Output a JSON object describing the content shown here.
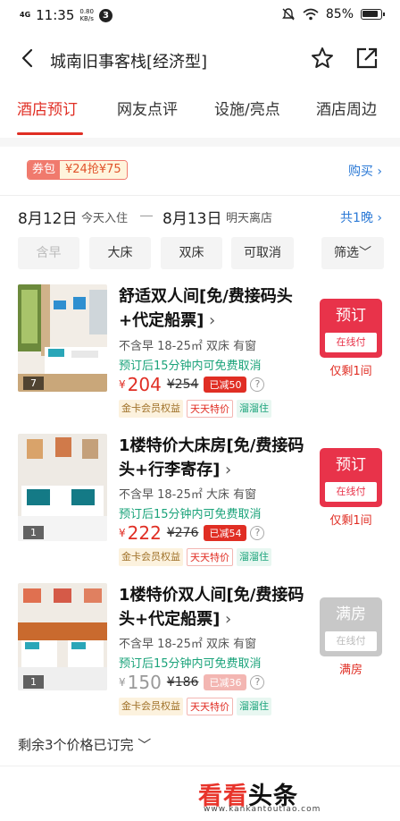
{
  "status_bar": {
    "network": "4G",
    "time": "11:35",
    "speed_value": "0.80",
    "speed_unit": "KB/s",
    "notification_count": "3",
    "battery": "85%"
  },
  "nav": {
    "title": "城南旧事客栈[经济型]",
    "icons": [
      "back-icon",
      "star-icon",
      "share-icon"
    ]
  },
  "tabs": [
    {
      "label": "酒店预订",
      "active": true
    },
    {
      "label": "网友点评",
      "active": false
    },
    {
      "label": "设施/亮点",
      "active": false
    },
    {
      "label": "酒店周边",
      "active": false
    }
  ],
  "coupon": {
    "tag": "券包",
    "text": "¥24抢¥75",
    "buy_label": "购买 ›"
  },
  "dates": {
    "checkin": "8月12日",
    "checkin_note": "今天入住",
    "checkout": "8月13日",
    "checkout_note": "明天离店",
    "nights": "共1晚 ›"
  },
  "filters": [
    {
      "label": "含早",
      "disabled": true
    },
    {
      "label": "大床",
      "disabled": false
    },
    {
      "label": "双床",
      "disabled": false
    },
    {
      "label": "可取消",
      "disabled": false
    },
    {
      "label": "筛选﹀",
      "disabled": false
    }
  ],
  "rooms": [
    {
      "name": "舒适双人间[免/费接码头+代定船票]",
      "photo_count": "7",
      "meta": "不含早 18-25㎡ 双床 有窗",
      "cancel": "预订后15分钟内可免费取消",
      "currency": "¥",
      "price": "204",
      "original_price": "¥254",
      "discount": "已减50",
      "help": "?",
      "tags": [
        "金卡会员权益",
        "天天特价",
        "溜溜住"
      ],
      "button_label": "预订",
      "button_sub": "在线付",
      "status": "仅剩1间",
      "sold_out": false
    },
    {
      "name": "1楼特价大床房[免/费接码头+行李寄存]",
      "photo_count": "1",
      "meta": "不含早 18-25㎡ 大床 有窗",
      "cancel": "预订后15分钟内可免费取消",
      "currency": "¥",
      "price": "222",
      "original_price": "¥276",
      "discount": "已减54",
      "help": "?",
      "tags": [
        "金卡会员权益",
        "天天特价",
        "溜溜住"
      ],
      "button_label": "预订",
      "button_sub": "在线付",
      "status": "仅剩1间",
      "sold_out": false
    },
    {
      "name": "1楼特价双人间[免/费接码头+代定船票]",
      "photo_count": "1",
      "meta": "不含早 18-25㎡ 双床 有窗",
      "cancel": "预订后15分钟内可免费取消",
      "currency": "¥",
      "price": "150",
      "original_price": "¥186",
      "discount": "已减36",
      "help": "?",
      "tags": [
        "金卡会员权益",
        "天天特价",
        "溜溜住"
      ],
      "button_label": "满房",
      "button_sub": "在线付",
      "status": "满房",
      "sold_out": true
    }
  ],
  "more": "剩余3个价格已订完 ﹀",
  "watermark": {
    "main": "看看",
    "tail": "头条",
    "url": "www.kankantoutiao.com"
  },
  "colors": {
    "accent": "#e02e24",
    "link": "#2c7ad6",
    "green": "#1aa37a",
    "button": "#e8334a",
    "sold_out": "#c8c8c8"
  }
}
